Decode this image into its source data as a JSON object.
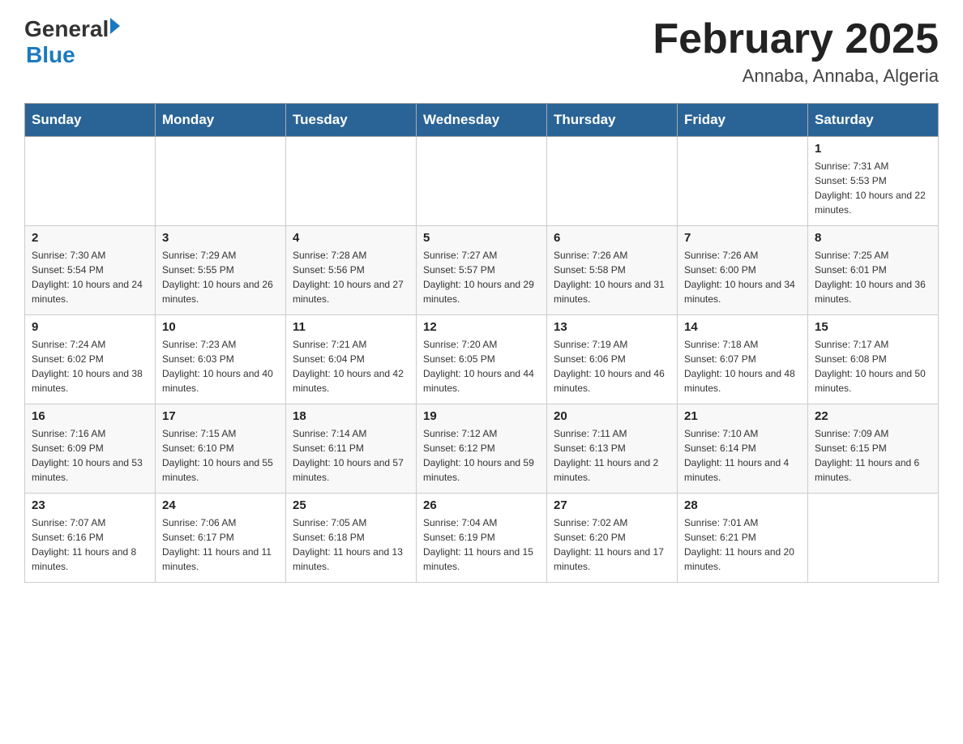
{
  "header": {
    "logo_general": "General",
    "logo_blue": "Blue",
    "title": "February 2025",
    "subtitle": "Annaba, Annaba, Algeria"
  },
  "weekdays": [
    "Sunday",
    "Monday",
    "Tuesday",
    "Wednesday",
    "Thursday",
    "Friday",
    "Saturday"
  ],
  "weeks": [
    [
      {
        "day": "",
        "info": ""
      },
      {
        "day": "",
        "info": ""
      },
      {
        "day": "",
        "info": ""
      },
      {
        "day": "",
        "info": ""
      },
      {
        "day": "",
        "info": ""
      },
      {
        "day": "",
        "info": ""
      },
      {
        "day": "1",
        "info": "Sunrise: 7:31 AM\nSunset: 5:53 PM\nDaylight: 10 hours and 22 minutes."
      }
    ],
    [
      {
        "day": "2",
        "info": "Sunrise: 7:30 AM\nSunset: 5:54 PM\nDaylight: 10 hours and 24 minutes."
      },
      {
        "day": "3",
        "info": "Sunrise: 7:29 AM\nSunset: 5:55 PM\nDaylight: 10 hours and 26 minutes."
      },
      {
        "day": "4",
        "info": "Sunrise: 7:28 AM\nSunset: 5:56 PM\nDaylight: 10 hours and 27 minutes."
      },
      {
        "day": "5",
        "info": "Sunrise: 7:27 AM\nSunset: 5:57 PM\nDaylight: 10 hours and 29 minutes."
      },
      {
        "day": "6",
        "info": "Sunrise: 7:26 AM\nSunset: 5:58 PM\nDaylight: 10 hours and 31 minutes."
      },
      {
        "day": "7",
        "info": "Sunrise: 7:26 AM\nSunset: 6:00 PM\nDaylight: 10 hours and 34 minutes."
      },
      {
        "day": "8",
        "info": "Sunrise: 7:25 AM\nSunset: 6:01 PM\nDaylight: 10 hours and 36 minutes."
      }
    ],
    [
      {
        "day": "9",
        "info": "Sunrise: 7:24 AM\nSunset: 6:02 PM\nDaylight: 10 hours and 38 minutes."
      },
      {
        "day": "10",
        "info": "Sunrise: 7:23 AM\nSunset: 6:03 PM\nDaylight: 10 hours and 40 minutes."
      },
      {
        "day": "11",
        "info": "Sunrise: 7:21 AM\nSunset: 6:04 PM\nDaylight: 10 hours and 42 minutes."
      },
      {
        "day": "12",
        "info": "Sunrise: 7:20 AM\nSunset: 6:05 PM\nDaylight: 10 hours and 44 minutes."
      },
      {
        "day": "13",
        "info": "Sunrise: 7:19 AM\nSunset: 6:06 PM\nDaylight: 10 hours and 46 minutes."
      },
      {
        "day": "14",
        "info": "Sunrise: 7:18 AM\nSunset: 6:07 PM\nDaylight: 10 hours and 48 minutes."
      },
      {
        "day": "15",
        "info": "Sunrise: 7:17 AM\nSunset: 6:08 PM\nDaylight: 10 hours and 50 minutes."
      }
    ],
    [
      {
        "day": "16",
        "info": "Sunrise: 7:16 AM\nSunset: 6:09 PM\nDaylight: 10 hours and 53 minutes."
      },
      {
        "day": "17",
        "info": "Sunrise: 7:15 AM\nSunset: 6:10 PM\nDaylight: 10 hours and 55 minutes."
      },
      {
        "day": "18",
        "info": "Sunrise: 7:14 AM\nSunset: 6:11 PM\nDaylight: 10 hours and 57 minutes."
      },
      {
        "day": "19",
        "info": "Sunrise: 7:12 AM\nSunset: 6:12 PM\nDaylight: 10 hours and 59 minutes."
      },
      {
        "day": "20",
        "info": "Sunrise: 7:11 AM\nSunset: 6:13 PM\nDaylight: 11 hours and 2 minutes."
      },
      {
        "day": "21",
        "info": "Sunrise: 7:10 AM\nSunset: 6:14 PM\nDaylight: 11 hours and 4 minutes."
      },
      {
        "day": "22",
        "info": "Sunrise: 7:09 AM\nSunset: 6:15 PM\nDaylight: 11 hours and 6 minutes."
      }
    ],
    [
      {
        "day": "23",
        "info": "Sunrise: 7:07 AM\nSunset: 6:16 PM\nDaylight: 11 hours and 8 minutes."
      },
      {
        "day": "24",
        "info": "Sunrise: 7:06 AM\nSunset: 6:17 PM\nDaylight: 11 hours and 11 minutes."
      },
      {
        "day": "25",
        "info": "Sunrise: 7:05 AM\nSunset: 6:18 PM\nDaylight: 11 hours and 13 minutes."
      },
      {
        "day": "26",
        "info": "Sunrise: 7:04 AM\nSunset: 6:19 PM\nDaylight: 11 hours and 15 minutes."
      },
      {
        "day": "27",
        "info": "Sunrise: 7:02 AM\nSunset: 6:20 PM\nDaylight: 11 hours and 17 minutes."
      },
      {
        "day": "28",
        "info": "Sunrise: 7:01 AM\nSunset: 6:21 PM\nDaylight: 11 hours and 20 minutes."
      },
      {
        "day": "",
        "info": ""
      }
    ]
  ]
}
